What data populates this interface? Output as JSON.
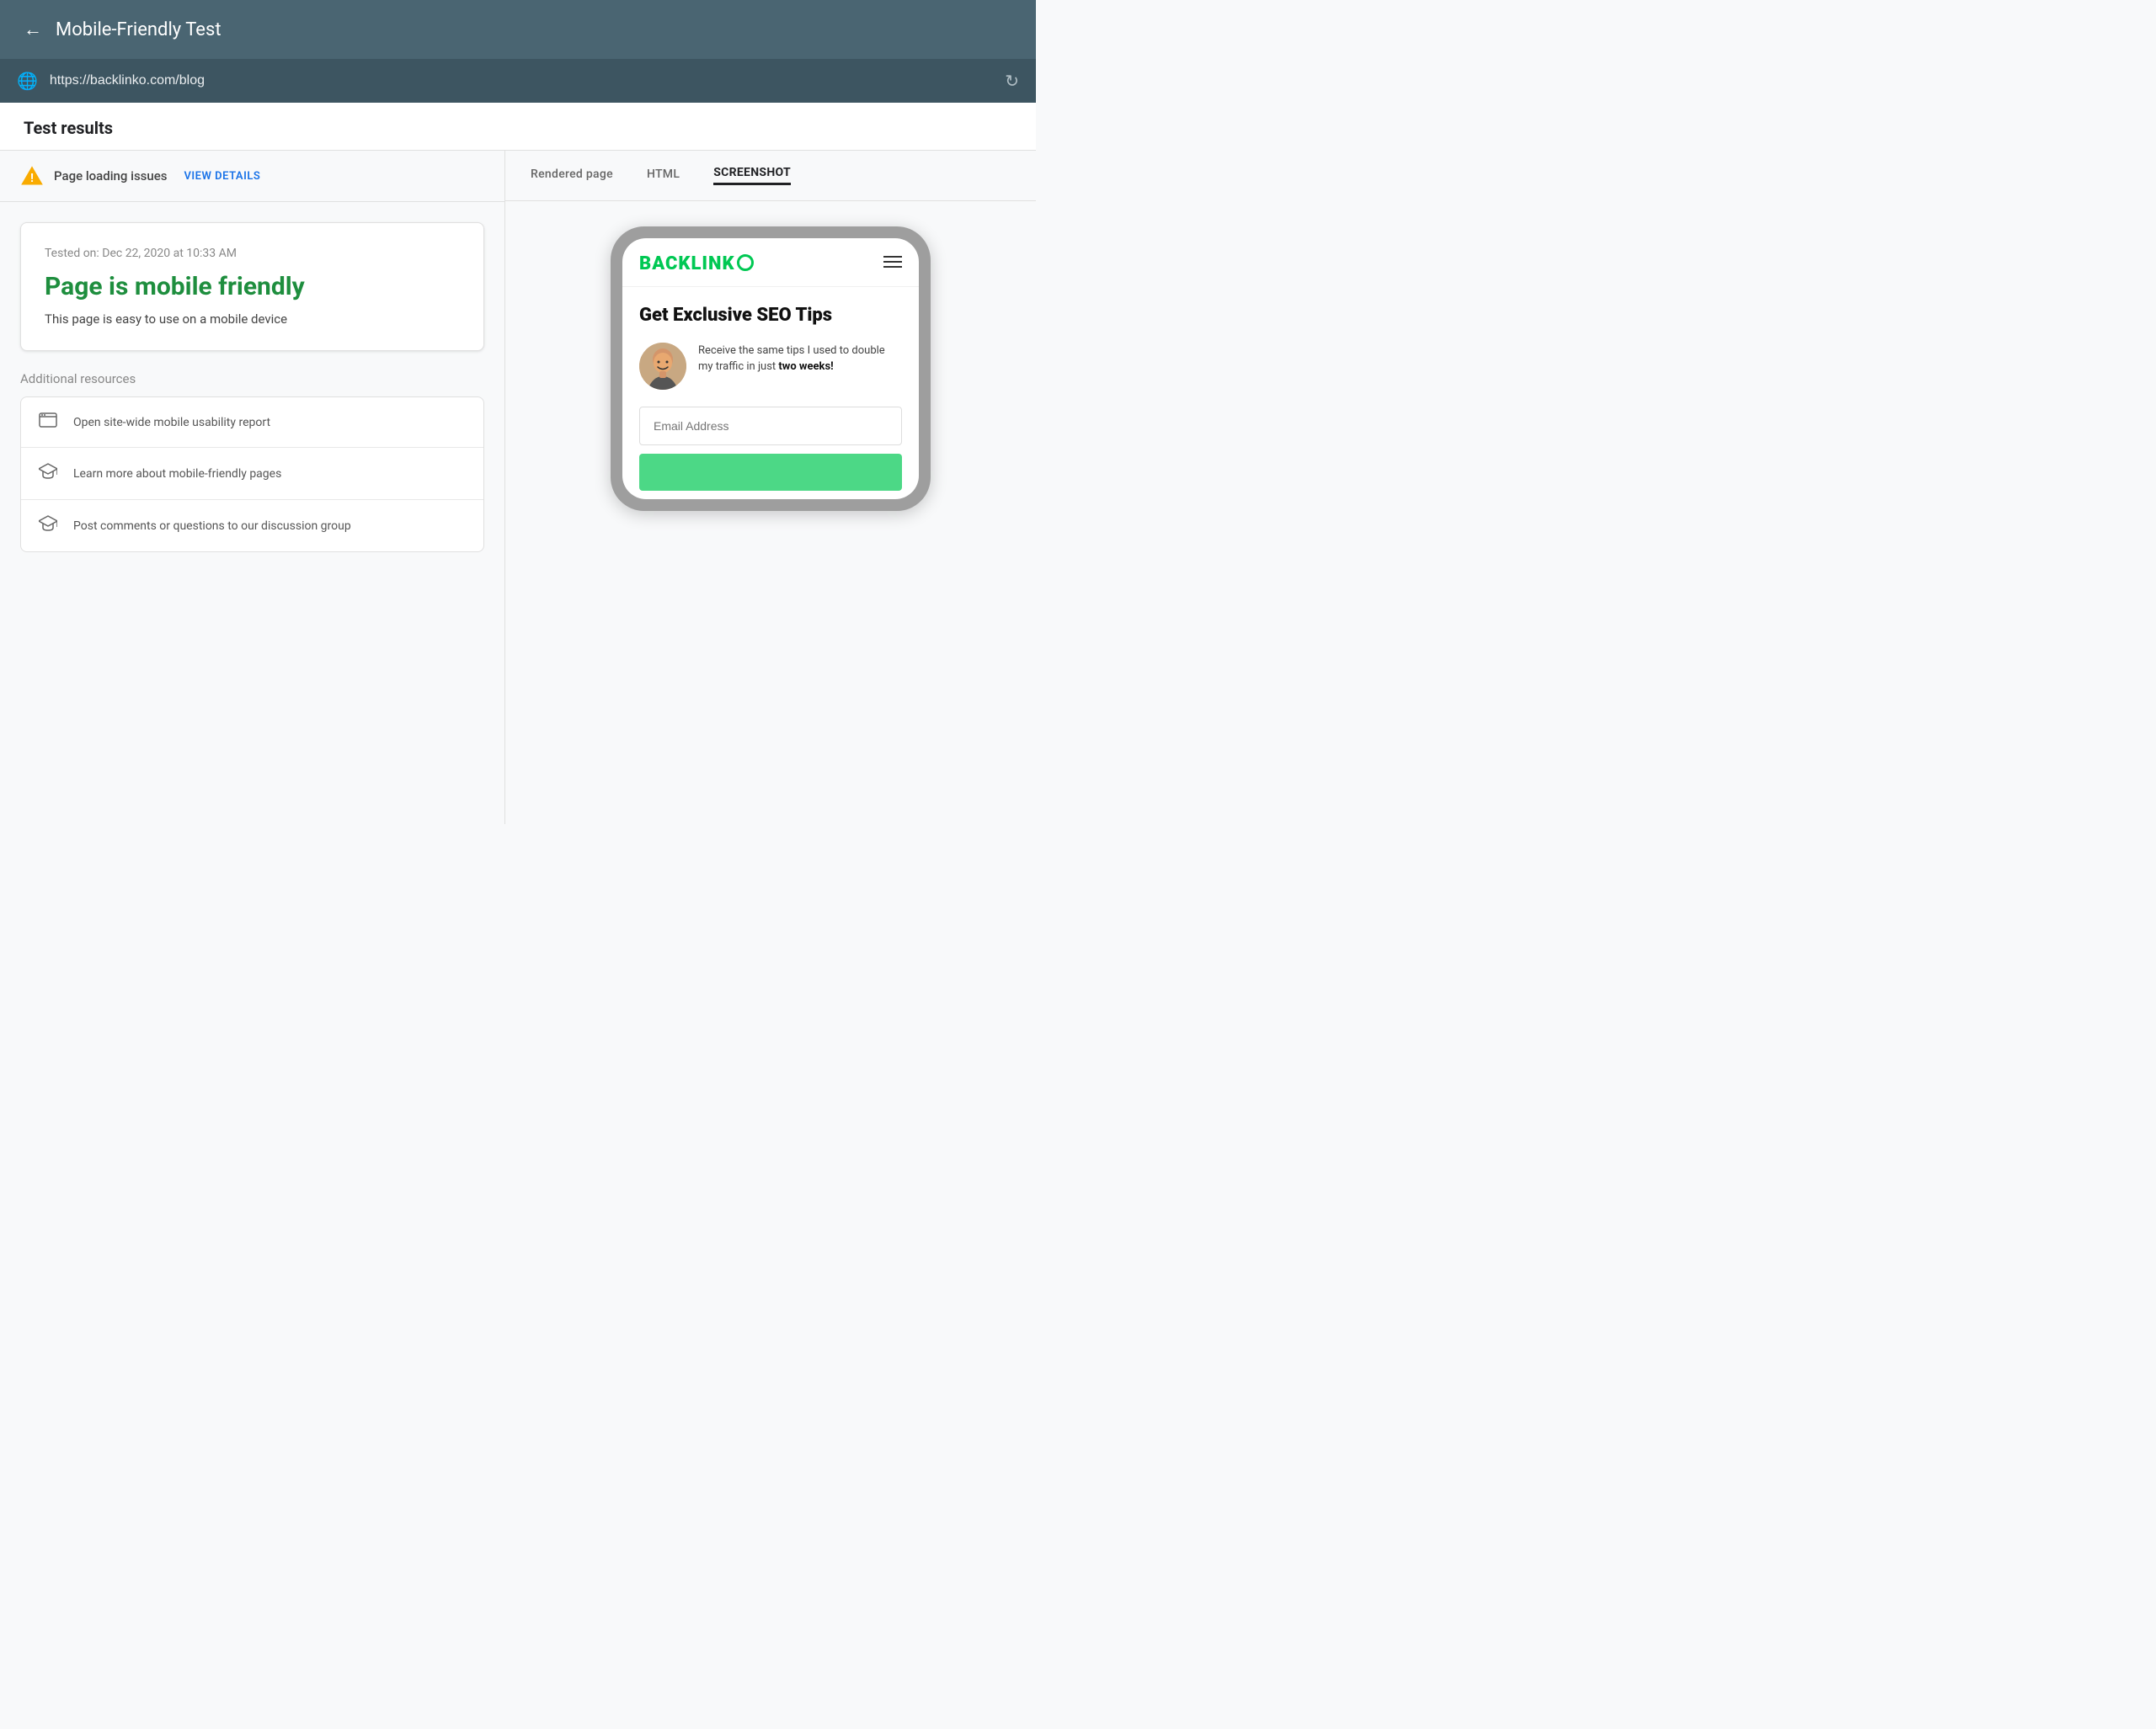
{
  "header": {
    "back_icon": "←",
    "title": "Mobile-Friendly Test"
  },
  "url_bar": {
    "url": "https://backlinko.com/blog",
    "globe_icon": "🌐",
    "refresh_icon": "↻"
  },
  "test_results": {
    "label": "Test results"
  },
  "issues_bar": {
    "warning_icon": "⚠",
    "issues_text": "Page loading issues",
    "view_details_label": "VIEW DETAILS"
  },
  "result_card": {
    "test_date": "Tested on: Dec 22, 2020 at 10:33 AM",
    "mobile_friendly_title": "Page is mobile friendly",
    "mobile_friendly_desc": "This page is easy to use on a mobile device"
  },
  "additional_resources": {
    "label": "Additional resources",
    "items": [
      {
        "icon": "browser",
        "text": "Open site-wide mobile usability report"
      },
      {
        "icon": "graduation",
        "text": "Learn more about mobile-friendly pages"
      },
      {
        "icon": "graduation",
        "text": "Post comments or questions to our discussion group"
      }
    ]
  },
  "right_panel": {
    "tabs": [
      {
        "label": "Rendered page",
        "active": false
      },
      {
        "label": "HTML",
        "active": false
      },
      {
        "label": "SCREENSHOT",
        "active": true
      }
    ]
  },
  "phone_preview": {
    "logo_text": "BACKLINKO",
    "headline": "Get Exclusive SEO Tips",
    "author_text_1": "Receive the same tips I used to double my traffic in just ",
    "author_text_bold": "two weeks!",
    "email_placeholder": "Email Address"
  },
  "colors": {
    "header_bg": "#4a6572",
    "url_bar_bg": "#3d5561",
    "green_accent": "#1e8e3e",
    "backlinko_green": "#00c853",
    "warning_yellow": "#f9ab00"
  }
}
